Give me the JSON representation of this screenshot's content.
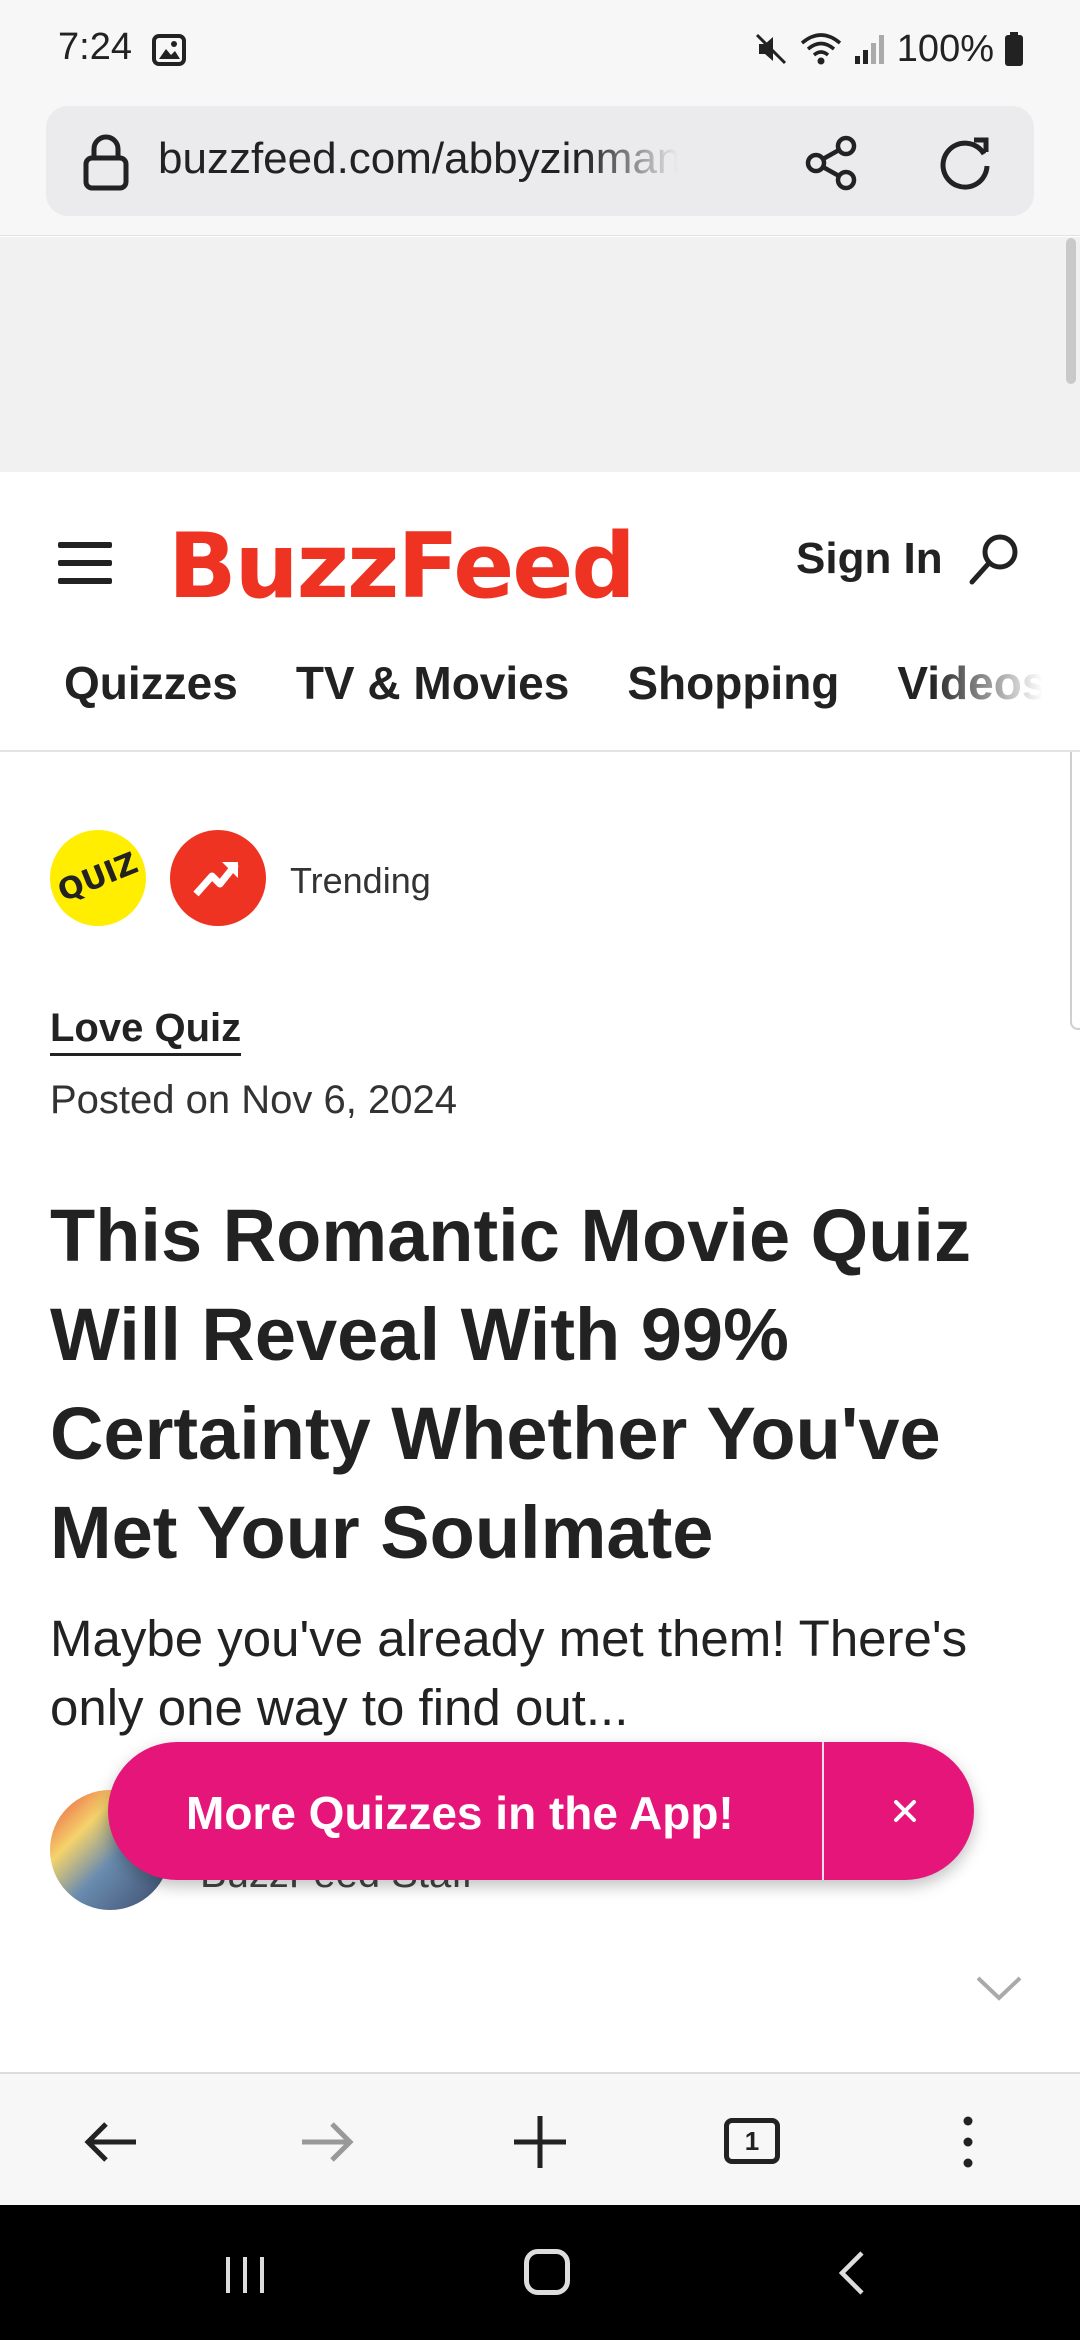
{
  "status_bar": {
    "time": "7:24",
    "battery": "100%",
    "icons": [
      "photo-icon",
      "mute-icon",
      "wifi-icon",
      "signal-icon",
      "battery-icon"
    ]
  },
  "browser": {
    "url": "buzzfeed.com/abbyzinman/romantic-movie-quiz",
    "toolbar_icons": [
      "back-icon",
      "forward-icon",
      "new-tab-icon",
      "tabs-icon",
      "menu-icon"
    ],
    "tab_count": "1"
  },
  "site_header": {
    "logo": "BuzzFeed",
    "sign_in": "Sign In",
    "nav": [
      "Quizzes",
      "TV & Movies",
      "Shopping",
      "Videos"
    ]
  },
  "badges": {
    "quiz": "QUIZ",
    "trending": "Trending"
  },
  "article": {
    "category": "Love Quiz",
    "posted": "Posted on Nov 6, 2024",
    "headline": "This Romantic Movie Quiz Will Reveal With 99% Certainty Whether You've Met Your Soulmate",
    "dek": "Maybe you've already met them! There's only one way to find out...",
    "author_role": "BuzzFeed Staff"
  },
  "app_promo": {
    "label": "More Quizzes in the App!"
  },
  "colors": {
    "brand_red": "#ee3322",
    "promo_pink": "#e5157a",
    "quiz_yellow": "#ffee00"
  }
}
